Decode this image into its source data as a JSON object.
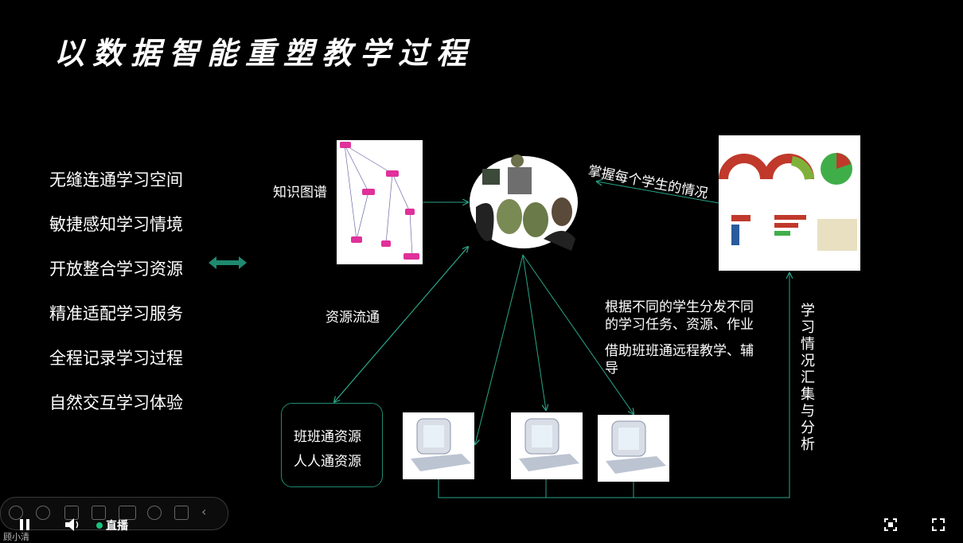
{
  "title": "以数据智能重塑教学过程",
  "left_list": [
    "无缝连通学习空间",
    "敏捷感知学习情境",
    "开放整合学习资源",
    "精准适配学习服务",
    "全程记录学习过程",
    "自然交互学习体验"
  ],
  "labels": {
    "knowledge_graph": "知识图谱",
    "master_each": "掌握每个学生的情况",
    "resource_flow": "资源流通",
    "distribute": "根据不同的学生分发不同的学习任务、资源、作业",
    "remote": "借助班班通远程教学、辅导",
    "collect": "学习情况汇集与分析"
  },
  "resources": [
    "班班通资源",
    "人人通资源"
  ],
  "player": {
    "live_label": "直播",
    "user_name": "顾小清"
  },
  "colors": {
    "accent": "#1f8a70",
    "background": "#000000"
  }
}
